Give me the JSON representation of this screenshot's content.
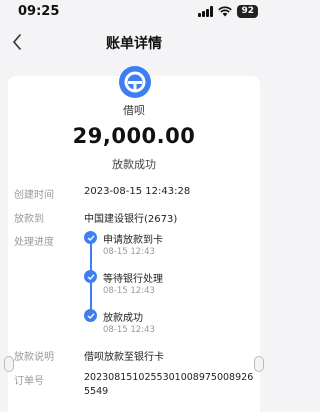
{
  "status_bar": {
    "time": "09:25",
    "battery": "92"
  },
  "nav": {
    "title": "账单详情"
  },
  "merchant": {
    "name": "借呗"
  },
  "amount": "29,000.00",
  "status": "放款成功",
  "details": {
    "created_label": "创建时间",
    "created_value": "2023-08-15 12:43:28",
    "loan_to_label": "放款到",
    "loan_to_value": "中国建设银行(2673)",
    "progress_label": "处理进度",
    "steps": [
      {
        "title": "申请放款到卡",
        "time": "08-15 12:43"
      },
      {
        "title": "等待银行处理",
        "time": "08-15 12:43"
      },
      {
        "title": "放款成功",
        "time": "08-15 12:43"
      }
    ],
    "desc_label": "放款说明",
    "desc_value": "借呗放款至银行卡",
    "order_label": "订单号",
    "order_value": "20230815102553010089750089265549"
  },
  "colors": {
    "accent": "#3d7ff2",
    "background": "#f4f4f6",
    "card": "#ffffff"
  }
}
